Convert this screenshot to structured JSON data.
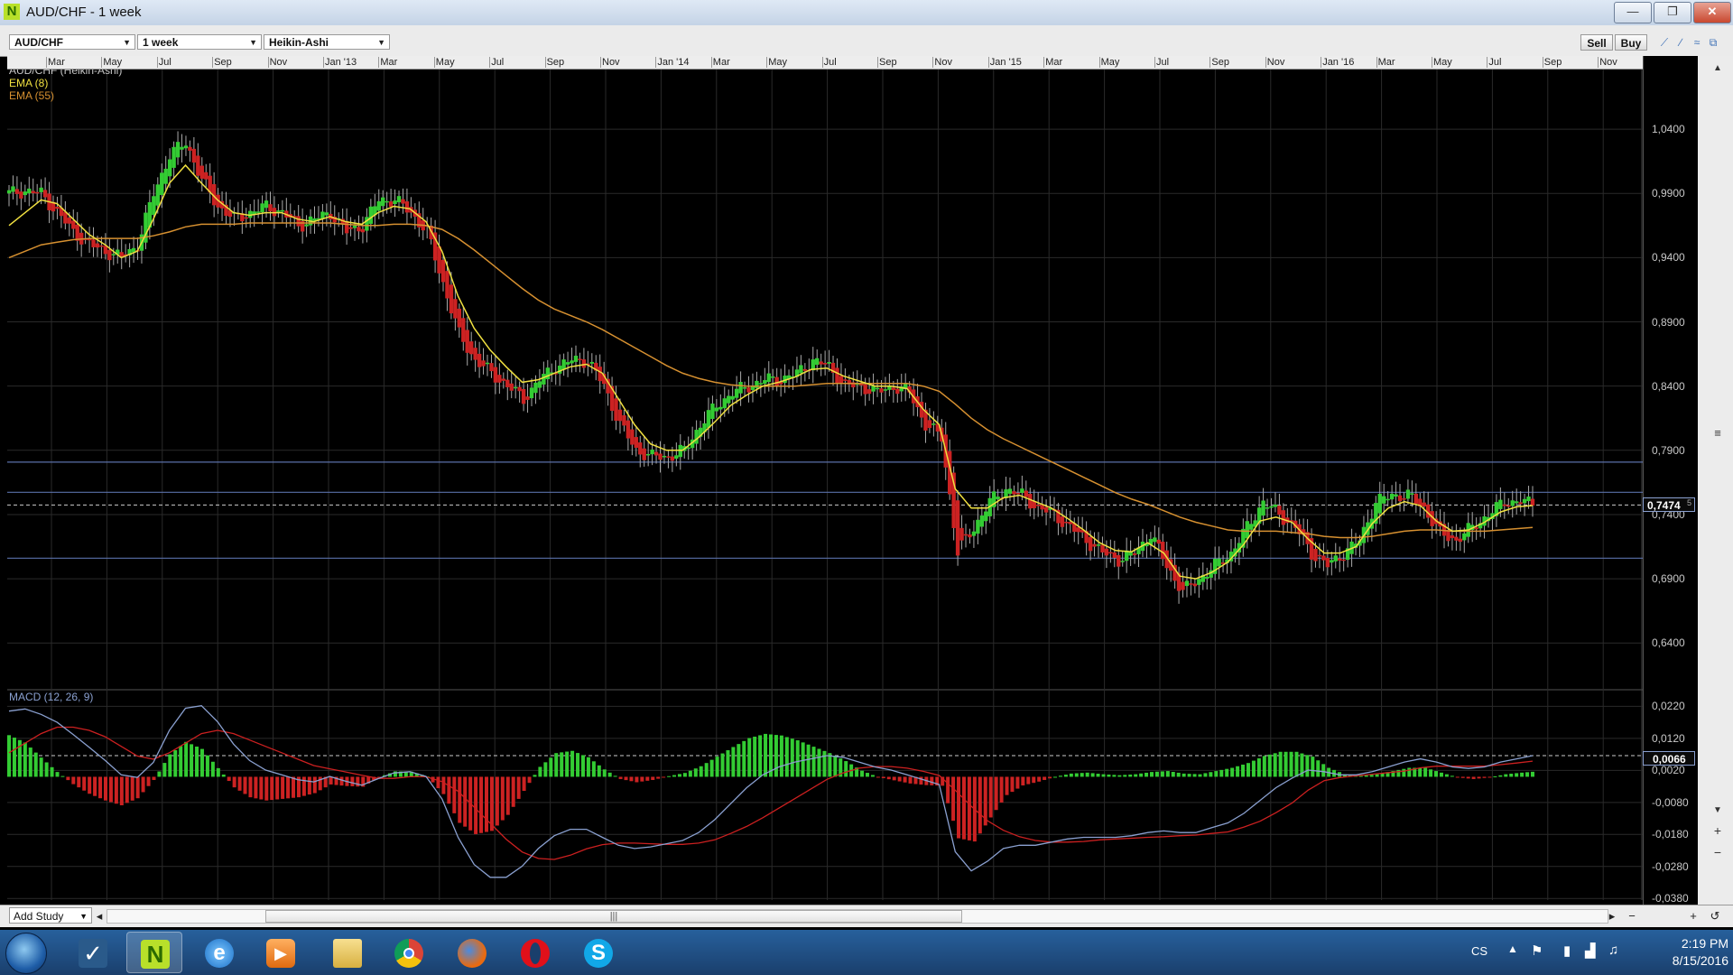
{
  "window": {
    "title": "AUD/CHF - 1 week",
    "min": "—",
    "max": "❐",
    "close": "✕"
  },
  "toolbar": {
    "symbol": "AUD/CHF",
    "period": "1 week",
    "chart_style": "Heikin-Ashi",
    "sell_label": "Sell",
    "buy_label": "Buy"
  },
  "price_panel": {
    "legend": [
      "AUD/CHF (Heikin-Ashi)",
      "EMA (8)",
      "EMA (55)"
    ],
    "current_price": "0,7474",
    "current_price_sup": "5"
  },
  "macd_panel": {
    "legend": "MACD (12, 26, 9)",
    "current_value": "0,0066"
  },
  "colors": {
    "bull": "#33cc33",
    "bear": "#cc2222",
    "ema_fast": "#f0e040",
    "ema_slow": "#d69030",
    "macd_line": "#8aa0d0",
    "signal_line": "#cc2020",
    "level_line": "#5a6fa8"
  },
  "footer": {
    "add_study": "Add Study",
    "thumb": "|||"
  },
  "taskbar": {
    "apps": [
      "app-icon",
      "nano-trader-icon",
      "internet-explorer-icon",
      "media-player-icon",
      "folder-icon",
      "chrome-icon",
      "firefox-icon",
      "opera-icon",
      "skype-icon"
    ],
    "lang": "CS",
    "time": "2:19 PM",
    "date": "8/15/2016"
  },
  "chart_data": {
    "type": "candlestick",
    "x_ticks": [
      "Mar",
      "May",
      "Jul",
      "Sep",
      "Nov",
      "Jan '13",
      "Mar",
      "May",
      "Jul",
      "Sep",
      "Nov",
      "Jan '14",
      "Mar",
      "May",
      "Jul",
      "Sep",
      "Nov",
      "Jan '15",
      "Mar",
      "May",
      "Jul",
      "Sep",
      "Nov",
      "Jan '16",
      "Mar",
      "May",
      "Jul",
      "Sep",
      "Nov"
    ],
    "y_ticks_price": [
      "1,0400",
      "0,9900",
      "0,9400",
      "0,8900",
      "0,8400",
      "0,7900",
      "0,7400",
      "0,6900",
      "0,6400"
    ],
    "y_ticks_macd": [
      "0,0220",
      "0,0120",
      "0,0020",
      "-0,0080",
      "-0,0180",
      "-0,0280",
      "-0,0380"
    ],
    "ylim_price": [
      0.605,
      1.09
    ],
    "ylim_macd": [
      -0.0385,
      0.0255
    ],
    "horizontal_levels": [
      0.7808,
      0.7573,
      0.706
    ],
    "current_price": 0.7474,
    "current_macd": 0.0066,
    "close_series": [
      0.99,
      0.992,
      0.99,
      0.975,
      0.96,
      0.95,
      0.945,
      0.94,
      0.95,
      0.99,
      1.02,
      1.03,
      1.0,
      0.98,
      0.97,
      0.975,
      0.98,
      0.975,
      0.965,
      0.97,
      0.975,
      0.96,
      0.965,
      0.985,
      0.985,
      0.975,
      0.96,
      0.92,
      0.88,
      0.86,
      0.85,
      0.84,
      0.83,
      0.845,
      0.855,
      0.86,
      0.86,
      0.84,
      0.81,
      0.79,
      0.785,
      0.785,
      0.79,
      0.81,
      0.825,
      0.835,
      0.84,
      0.845,
      0.845,
      0.85,
      0.86,
      0.855,
      0.84,
      0.84,
      0.835,
      0.84,
      0.835,
      0.81,
      0.8,
      0.71,
      0.73,
      0.75,
      0.76,
      0.755,
      0.745,
      0.74,
      0.73,
      0.72,
      0.71,
      0.705,
      0.71,
      0.725,
      0.7,
      0.68,
      0.69,
      0.7,
      0.71,
      0.73,
      0.75,
      0.74,
      0.73,
      0.71,
      0.7,
      0.71,
      0.72,
      0.75,
      0.755,
      0.755,
      0.745,
      0.725,
      0.72,
      0.73,
      0.74,
      0.75,
      0.75,
      0.748
    ],
    "ema_fast_series": [
      0.965,
      0.975,
      0.985,
      0.982,
      0.97,
      0.958,
      0.95,
      0.94,
      0.945,
      0.97,
      0.998,
      1.012,
      0.998,
      0.985,
      0.975,
      0.973,
      0.975,
      0.975,
      0.97,
      0.968,
      0.972,
      0.968,
      0.966,
      0.975,
      0.98,
      0.978,
      0.968,
      0.945,
      0.91,
      0.885,
      0.868,
      0.855,
      0.843,
      0.845,
      0.85,
      0.855,
      0.857,
      0.85,
      0.83,
      0.81,
      0.795,
      0.79,
      0.79,
      0.8,
      0.812,
      0.825,
      0.833,
      0.84,
      0.843,
      0.847,
      0.853,
      0.854,
      0.848,
      0.844,
      0.84,
      0.84,
      0.838,
      0.822,
      0.81,
      0.76,
      0.745,
      0.745,
      0.753,
      0.755,
      0.75,
      0.745,
      0.737,
      0.728,
      0.718,
      0.712,
      0.711,
      0.718,
      0.71,
      0.692,
      0.69,
      0.695,
      0.703,
      0.717,
      0.735,
      0.738,
      0.734,
      0.721,
      0.71,
      0.71,
      0.715,
      0.733,
      0.745,
      0.75,
      0.747,
      0.735,
      0.727,
      0.728,
      0.734,
      0.742,
      0.746,
      0.747
    ],
    "ema_slow_series": [
      0.94,
      0.945,
      0.95,
      0.952,
      0.954,
      0.955,
      0.955,
      0.955,
      0.955,
      0.957,
      0.96,
      0.964,
      0.966,
      0.966,
      0.966,
      0.967,
      0.967,
      0.967,
      0.967,
      0.967,
      0.967,
      0.966,
      0.965,
      0.965,
      0.966,
      0.966,
      0.965,
      0.962,
      0.955,
      0.946,
      0.936,
      0.926,
      0.916,
      0.907,
      0.9,
      0.895,
      0.89,
      0.884,
      0.877,
      0.87,
      0.863,
      0.856,
      0.85,
      0.846,
      0.843,
      0.841,
      0.84,
      0.84,
      0.84,
      0.84,
      0.841,
      0.842,
      0.842,
      0.842,
      0.842,
      0.842,
      0.842,
      0.84,
      0.836,
      0.826,
      0.815,
      0.806,
      0.799,
      0.793,
      0.787,
      0.781,
      0.775,
      0.769,
      0.763,
      0.757,
      0.752,
      0.748,
      0.743,
      0.738,
      0.734,
      0.731,
      0.728,
      0.727,
      0.727,
      0.727,
      0.726,
      0.725,
      0.723,
      0.722,
      0.722,
      0.723,
      0.725,
      0.727,
      0.728,
      0.728,
      0.727,
      0.727,
      0.727,
      0.728,
      0.729,
      0.73
    ],
    "macd_series": [
      0.0205,
      0.0212,
      0.0195,
      0.017,
      0.0132,
      0.0092,
      0.0051,
      0.0006,
      -0.0002,
      0.0045,
      0.0145,
      0.0214,
      0.0222,
      0.0172,
      0.0102,
      0.0051,
      0.0021,
      0.0006,
      -0.0009,
      -0.0016,
      0.0001,
      -0.0014,
      -0.0026,
      -0.0006,
      0.0012,
      0.0016,
      0.0001,
      -0.0069,
      -0.0189,
      -0.0274,
      -0.0314,
      -0.0314,
      -0.0279,
      -0.0224,
      -0.0184,
      -0.0164,
      -0.0164,
      -0.0189,
      -0.0214,
      -0.0224,
      -0.0219,
      -0.0209,
      -0.0199,
      -0.0174,
      -0.0134,
      -0.0084,
      -0.0034,
      0.0006,
      0.0031,
      0.0046,
      0.0056,
      0.0066,
      0.0061,
      0.0046,
      0.0031,
      0.0021,
      0.0006,
      -0.0009,
      -0.0024,
      -0.0234,
      -0.0294,
      -0.0264,
      -0.0224,
      -0.0214,
      -0.0214,
      -0.0204,
      -0.0194,
      -0.0189,
      -0.0189,
      -0.0189,
      -0.0184,
      -0.0174,
      -0.0169,
      -0.0174,
      -0.0174,
      -0.0159,
      -0.0144,
      -0.0114,
      -0.0074,
      -0.0034,
      -0.0004,
      0.0021,
      0.0016,
      0.0006,
      0.0006,
      0.0016,
      0.0031,
      0.0046,
      0.0056,
      0.0046,
      0.0031,
      0.0026,
      0.0031,
      0.0046,
      0.0056,
      0.0066
    ],
    "signal_series": [
      0.0075,
      0.0105,
      0.0135,
      0.0155,
      0.0155,
      0.0145,
      0.0125,
      0.0095,
      0.0065,
      0.0055,
      0.0075,
      0.0105,
      0.0135,
      0.0145,
      0.0135,
      0.0115,
      0.0095,
      0.0075,
      0.0055,
      0.0035,
      0.0025,
      0.0015,
      0.0005,
      -0.0005,
      -0.0005,
      0.0,
      0.0,
      -0.0015,
      -0.0045,
      -0.0095,
      -0.0145,
      -0.0195,
      -0.0235,
      -0.0255,
      -0.0258,
      -0.0245,
      -0.0225,
      -0.0212,
      -0.0207,
      -0.0207,
      -0.0209,
      -0.0211,
      -0.0211,
      -0.0207,
      -0.0197,
      -0.0177,
      -0.0155,
      -0.0128,
      -0.0098,
      -0.0068,
      -0.0038,
      -0.0008,
      0.0012,
      0.0027,
      0.0032,
      0.0032,
      0.0027,
      0.0017,
      0.0004,
      -0.0042,
      -0.0092,
      -0.0137,
      -0.0167,
      -0.0187,
      -0.0199,
      -0.0204,
      -0.0204,
      -0.0202,
      -0.0197,
      -0.0194,
      -0.0192,
      -0.0189,
      -0.0187,
      -0.0184,
      -0.0182,
      -0.0177,
      -0.0172,
      -0.0157,
      -0.0139,
      -0.0112,
      -0.0082,
      -0.0042,
      -0.0012,
      -0.0002,
      0.0003,
      0.0008,
      0.0013,
      0.0018,
      0.0028,
      0.0033,
      0.0033,
      0.0033,
      0.0033,
      0.0038,
      0.0043,
      0.0049
    ]
  }
}
